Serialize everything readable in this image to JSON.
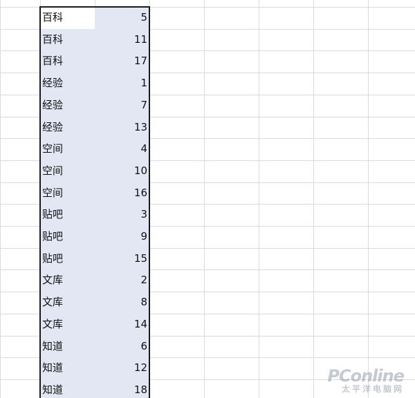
{
  "spreadsheet": {
    "selected_range": {
      "rows": [
        {
          "label": "百科",
          "value": "5"
        },
        {
          "label": "百科",
          "value": "11"
        },
        {
          "label": "百科",
          "value": "17"
        },
        {
          "label": "经验",
          "value": "1"
        },
        {
          "label": "经验",
          "value": "7"
        },
        {
          "label": "经验",
          "value": "13"
        },
        {
          "label": "空间",
          "value": "4"
        },
        {
          "label": "空间",
          "value": "10"
        },
        {
          "label": "空间",
          "value": "16"
        },
        {
          "label": "贴吧",
          "value": "3"
        },
        {
          "label": "贴吧",
          "value": "9"
        },
        {
          "label": "贴吧",
          "value": "15"
        },
        {
          "label": "文库",
          "value": "2"
        },
        {
          "label": "文库",
          "value": "8"
        },
        {
          "label": "文库",
          "value": "14"
        },
        {
          "label": "知道",
          "value": "6"
        },
        {
          "label": "知道",
          "value": "12"
        },
        {
          "label": "知道",
          "value": "18"
        }
      ]
    },
    "colors": {
      "gridline": "#d6dae6",
      "selection_fill": "#e3e7f3",
      "selection_border": "#1a1a1a",
      "active_cell": "#ffffff"
    }
  },
  "watermark": {
    "brand": "PConline",
    "subtitle": "太平洋电脑网"
  }
}
